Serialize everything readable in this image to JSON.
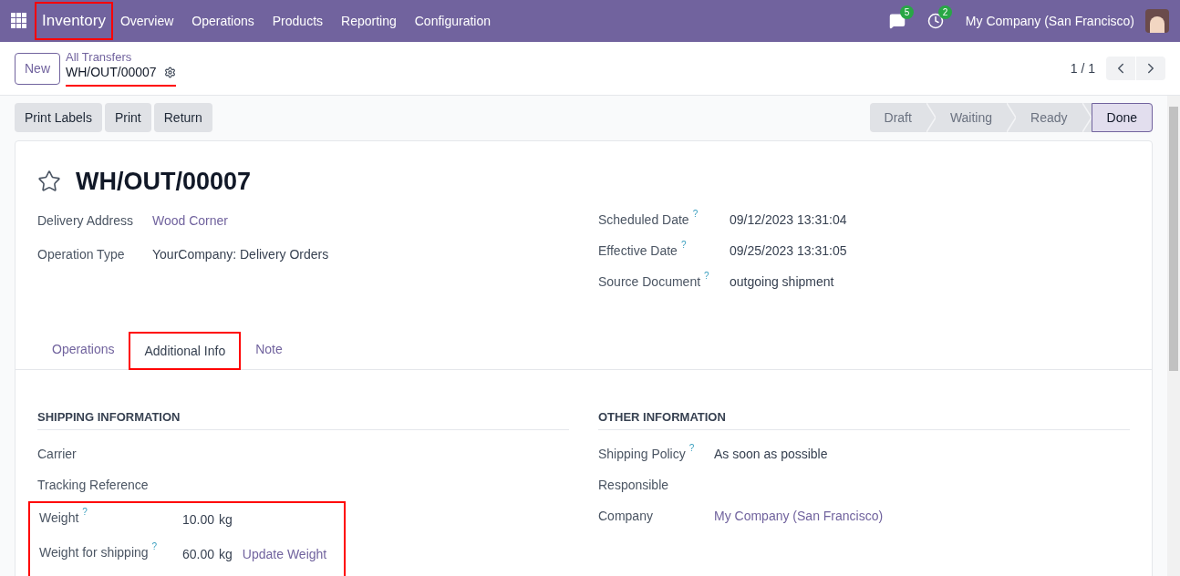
{
  "navbar": {
    "app": {
      "label": "Inventory",
      "highlighted": true
    },
    "menu": [
      "Overview",
      "Operations",
      "Products",
      "Reporting",
      "Configuration"
    ],
    "messages_count": "5",
    "activities_count": "2",
    "company": "My Company (San Francisco)"
  },
  "control_panel": {
    "new_button": "New",
    "breadcrumb_parent": "All Transfers",
    "breadcrumb_current": "WH/OUT/00007",
    "breadcrumb_highlighted": true,
    "pager": "1 / 1"
  },
  "actions": [
    "Print Labels",
    "Print",
    "Return"
  ],
  "stages": [
    {
      "label": "Draft",
      "selected": false
    },
    {
      "label": "Waiting",
      "selected": false
    },
    {
      "label": "Ready",
      "selected": false
    },
    {
      "label": "Done",
      "selected": true
    }
  ],
  "record": {
    "title": "WH/OUT/00007",
    "starred": false,
    "left_fields": [
      {
        "label": "Delivery Address",
        "value": "Wood Corner",
        "kind": "link"
      },
      {
        "label": "Operation Type",
        "value": "YourCompany: Delivery Orders",
        "kind": "text"
      }
    ],
    "right_fields": [
      {
        "label": "Scheduled Date",
        "help": "?",
        "value": "09/12/2023 13:31:04",
        "kind": "text"
      },
      {
        "label": "Effective Date",
        "help": "?",
        "value": "09/25/2023 13:31:05",
        "kind": "text"
      },
      {
        "label": "Source Document",
        "help": "?",
        "value": "outgoing shipment",
        "kind": "text"
      }
    ]
  },
  "tabs": [
    {
      "label": "Operations",
      "selected": false,
      "highlighted": false
    },
    {
      "label": "Additional Info",
      "selected": true,
      "highlighted": true
    },
    {
      "label": "Note",
      "selected": false,
      "highlighted": false
    }
  ],
  "shipping": {
    "heading": "SHIPPING INFORMATION",
    "fields": [
      {
        "label": "Carrier"
      },
      {
        "label": "Tracking Reference"
      }
    ],
    "weight_highlighted": true,
    "weights": [
      {
        "label": "Weight",
        "help": "?",
        "value": "10.00",
        "unit": "kg"
      },
      {
        "label": "Weight for shipping",
        "help": "?",
        "value": "60.00",
        "unit": "kg",
        "action": "Update Weight"
      }
    ]
  },
  "other": {
    "heading": "OTHER INFORMATION",
    "fields": [
      {
        "label": "Shipping Policy",
        "help": "?",
        "value": "As soon as possible",
        "kind": "text"
      },
      {
        "label": "Responsible"
      },
      {
        "label": "Company",
        "value": "My Company (San Francisco)",
        "kind": "link"
      }
    ]
  }
}
